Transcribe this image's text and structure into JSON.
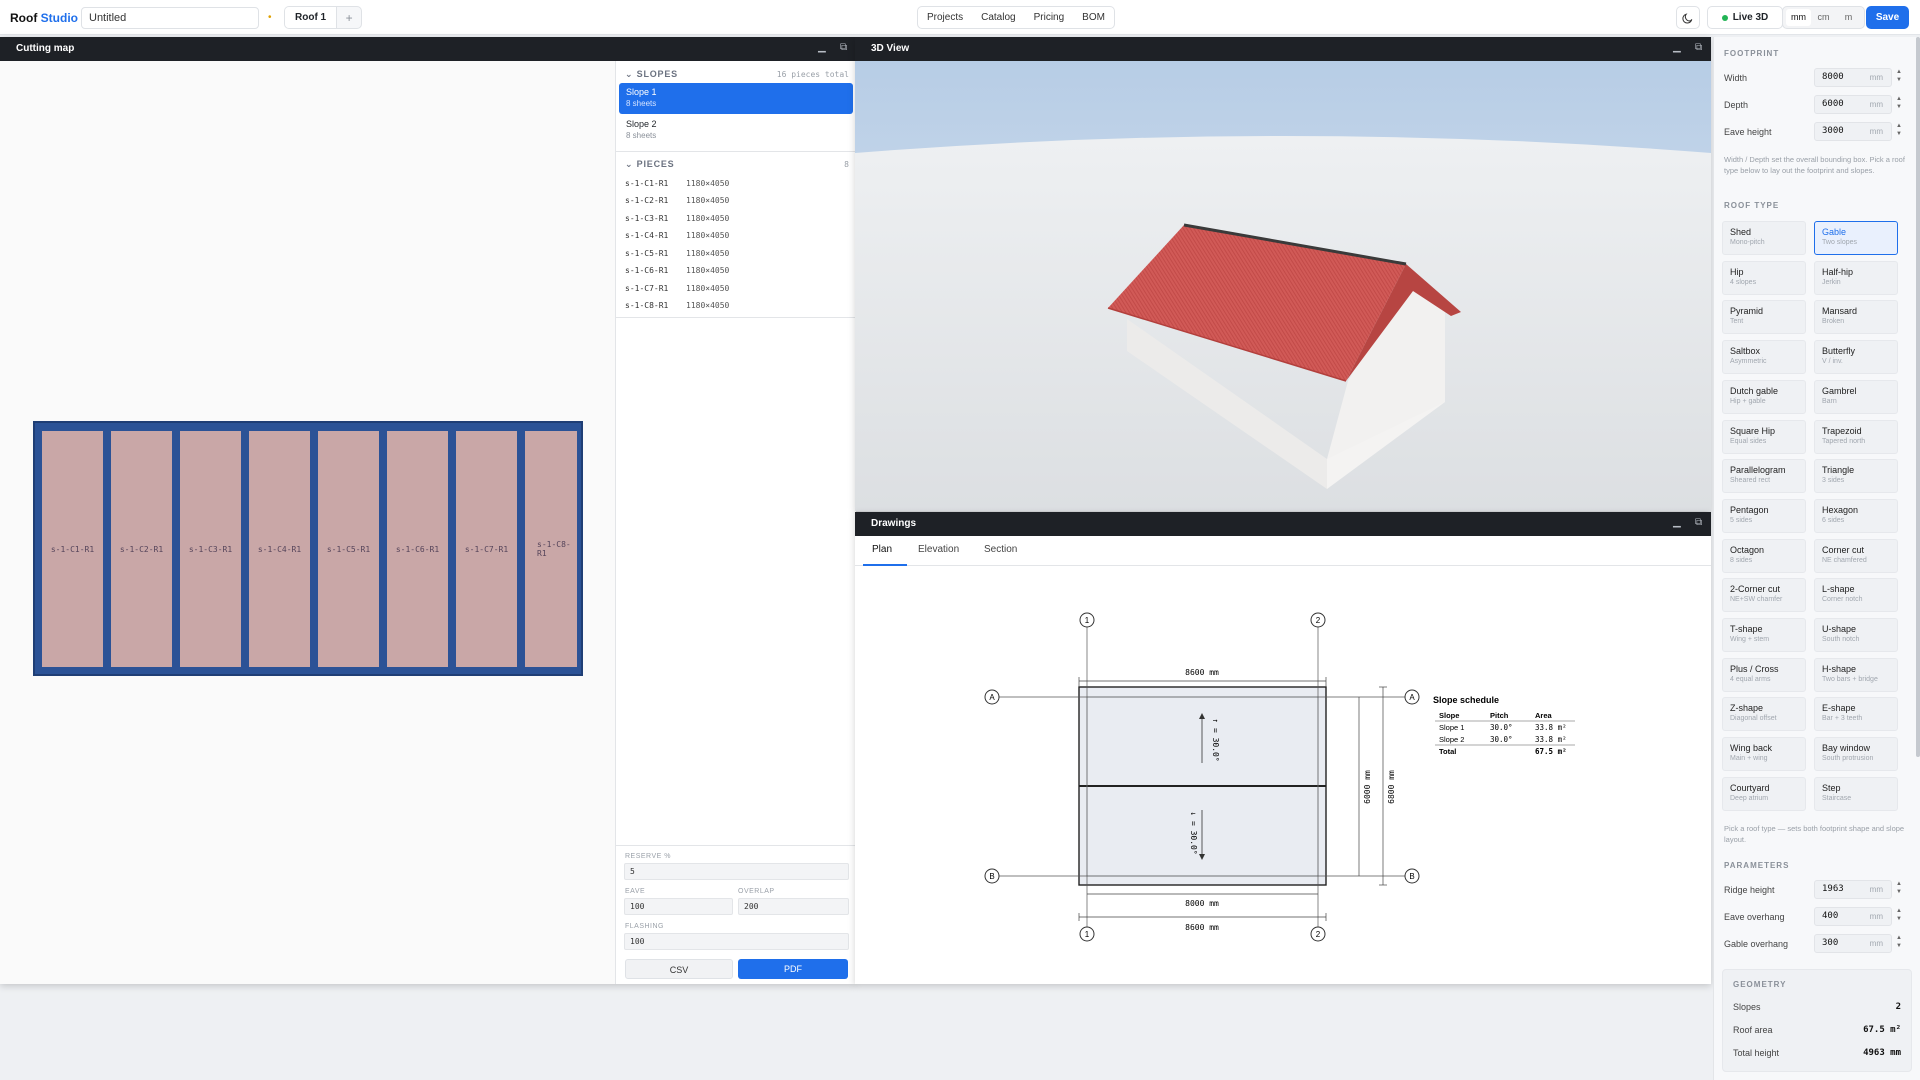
{
  "app": {
    "name_part1": "Roof",
    "name_part2": "Studio",
    "doc_title": "Untitled",
    "dirty_marker": "•"
  },
  "tabs": {
    "items": [
      "Roof 1"
    ],
    "add": "+"
  },
  "nav": [
    "Projects",
    "Catalog",
    "Pricing",
    "BOM"
  ],
  "toolbar": {
    "live3d": "Live 3D",
    "units": [
      "mm",
      "cm",
      "m"
    ],
    "active_unit": "mm",
    "save": "Save"
  },
  "colors": {
    "accent": "#1f6feb",
    "sheet_board": "#2b5296",
    "sheet": "#c9a7a7",
    "roof": "#cf5552",
    "live": "#22b455"
  },
  "cutting_map": {
    "title": "Cutting map",
    "sheets": [
      "s-1-C1-R1",
      "s-1-C2-R1",
      "s-1-C3-R1",
      "s-1-C4-R1",
      "s-1-C5-R1",
      "s-1-C6-R1",
      "s-1-C7-R1",
      "s-1-C8-R1"
    ],
    "slopes_header": "SLOPES",
    "pieces_total": "16 pieces total",
    "slopes": [
      {
        "name": "Slope 1",
        "sheets": "8 sheets"
      },
      {
        "name": "Slope 2",
        "sheets": "8 sheets"
      }
    ],
    "pieces_header": "PIECES",
    "pieces_count": "8",
    "pieces": [
      {
        "id": "s-1-C1-R1",
        "dim": "1180×4050"
      },
      {
        "id": "s-1-C2-R1",
        "dim": "1180×4050"
      },
      {
        "id": "s-1-C3-R1",
        "dim": "1180×4050"
      },
      {
        "id": "s-1-C4-R1",
        "dim": "1180×4050"
      },
      {
        "id": "s-1-C5-R1",
        "dim": "1180×4050"
      },
      {
        "id": "s-1-C6-R1",
        "dim": "1180×4050"
      },
      {
        "id": "s-1-C7-R1",
        "dim": "1180×4050"
      },
      {
        "id": "s-1-C8-R1",
        "dim": "1180×4050"
      }
    ],
    "fields": {
      "reserve_label": "RESERVE %",
      "reserve": "5",
      "eave_label": "EAVE",
      "eave": "100",
      "overlap_label": "OVERLAP",
      "overlap": "200",
      "flashing_label": "FLASHING",
      "flashing": "100"
    },
    "export": {
      "csv": "CSV",
      "pdf": "PDF"
    }
  },
  "view3d": {
    "title": "3D View"
  },
  "drawings": {
    "title": "Drawings",
    "tabs": [
      "Plan",
      "Elevation",
      "Section"
    ],
    "active_tab": "Plan",
    "plan": {
      "overall_width": "8600 mm",
      "inner_width": "8000 mm",
      "bottom_overall": "8600 mm",
      "depth_inner": "6000 mm",
      "depth_overall": "6800 mm",
      "grid_numbers": [
        "1",
        "2"
      ],
      "grid_letters": [
        "A",
        "B"
      ],
      "slope_label_1": "↑ = 30.0°",
      "slope_label_2": "↓ = 30.0°"
    },
    "schedule": {
      "title": "Slope schedule",
      "headers": [
        "Slope",
        "Pitch",
        "Area"
      ],
      "rows": [
        {
          "slope": "Slope 1",
          "pitch": "30.0°",
          "area": "33.8 m²"
        },
        {
          "slope": "Slope 2",
          "pitch": "30.0°",
          "area": "33.8 m²"
        }
      ],
      "total_label": "Total",
      "total_area": "67.5 m²"
    }
  },
  "footprint": {
    "header": "FOOTPRINT",
    "params": [
      {
        "label": "Width",
        "value": "8000",
        "unit": "mm"
      },
      {
        "label": "Depth",
        "value": "6000",
        "unit": "mm"
      },
      {
        "label": "Eave height",
        "value": "3000",
        "unit": "mm"
      }
    ],
    "help": "Width / Depth set the overall bounding box. Pick a roof type below to lay out the footprint and slopes."
  },
  "roof_type": {
    "header": "ROOF TYPE",
    "active": "Gable",
    "items": [
      {
        "name": "Shed",
        "sub": "Mono-pitch"
      },
      {
        "name": "Gable",
        "sub": "Two slopes"
      },
      {
        "name": "Hip",
        "sub": "4 slopes"
      },
      {
        "name": "Half-hip",
        "sub": "Jerkin"
      },
      {
        "name": "Pyramid",
        "sub": "Tent"
      },
      {
        "name": "Mansard",
        "sub": "Broken"
      },
      {
        "name": "Saltbox",
        "sub": "Asymmetric"
      },
      {
        "name": "Butterfly",
        "sub": "V / inv."
      },
      {
        "name": "Dutch gable",
        "sub": "Hip + gable"
      },
      {
        "name": "Gambrel",
        "sub": "Barn"
      },
      {
        "name": "Square Hip",
        "sub": "Equal sides"
      },
      {
        "name": "Trapezoid",
        "sub": "Tapered north"
      },
      {
        "name": "Parallelogram",
        "sub": "Sheared rect"
      },
      {
        "name": "Triangle",
        "sub": "3 sides"
      },
      {
        "name": "Pentagon",
        "sub": "5 sides"
      },
      {
        "name": "Hexagon",
        "sub": "6 sides"
      },
      {
        "name": "Octagon",
        "sub": "8 sides"
      },
      {
        "name": "Corner cut",
        "sub": "NE chamfered"
      },
      {
        "name": "2-Corner cut",
        "sub": "NE+SW chamfer"
      },
      {
        "name": "L-shape",
        "sub": "Corner notch"
      },
      {
        "name": "T-shape",
        "sub": "Wing + stem"
      },
      {
        "name": "U-shape",
        "sub": "South notch"
      },
      {
        "name": "Plus / Cross",
        "sub": "4 equal arms"
      },
      {
        "name": "H-shape",
        "sub": "Two bars + bridge"
      },
      {
        "name": "Z-shape",
        "sub": "Diagonal offset"
      },
      {
        "name": "E-shape",
        "sub": "Bar + 3 teeth"
      },
      {
        "name": "Wing back",
        "sub": "Main + wing"
      },
      {
        "name": "Bay window",
        "sub": "South protrusion"
      },
      {
        "name": "Courtyard",
        "sub": "Deep atrium"
      },
      {
        "name": "Step",
        "sub": "Staircase"
      }
    ],
    "help": "Pick a roof type — sets both footprint shape and slope layout."
  },
  "parameters": {
    "header": "PARAMETERS",
    "params": [
      {
        "label": "Ridge height",
        "value": "1963",
        "unit": "mm"
      },
      {
        "label": "Eave overhang",
        "value": "400",
        "unit": "mm"
      },
      {
        "label": "Gable overhang",
        "value": "300",
        "unit": "mm"
      }
    ]
  },
  "geometry": {
    "header": "GEOMETRY",
    "rows": [
      {
        "label": "Slopes",
        "value": "2"
      },
      {
        "label": "Roof area",
        "value": "67.5 m²"
      },
      {
        "label": "Total height",
        "value": "4963 mm"
      }
    ]
  }
}
